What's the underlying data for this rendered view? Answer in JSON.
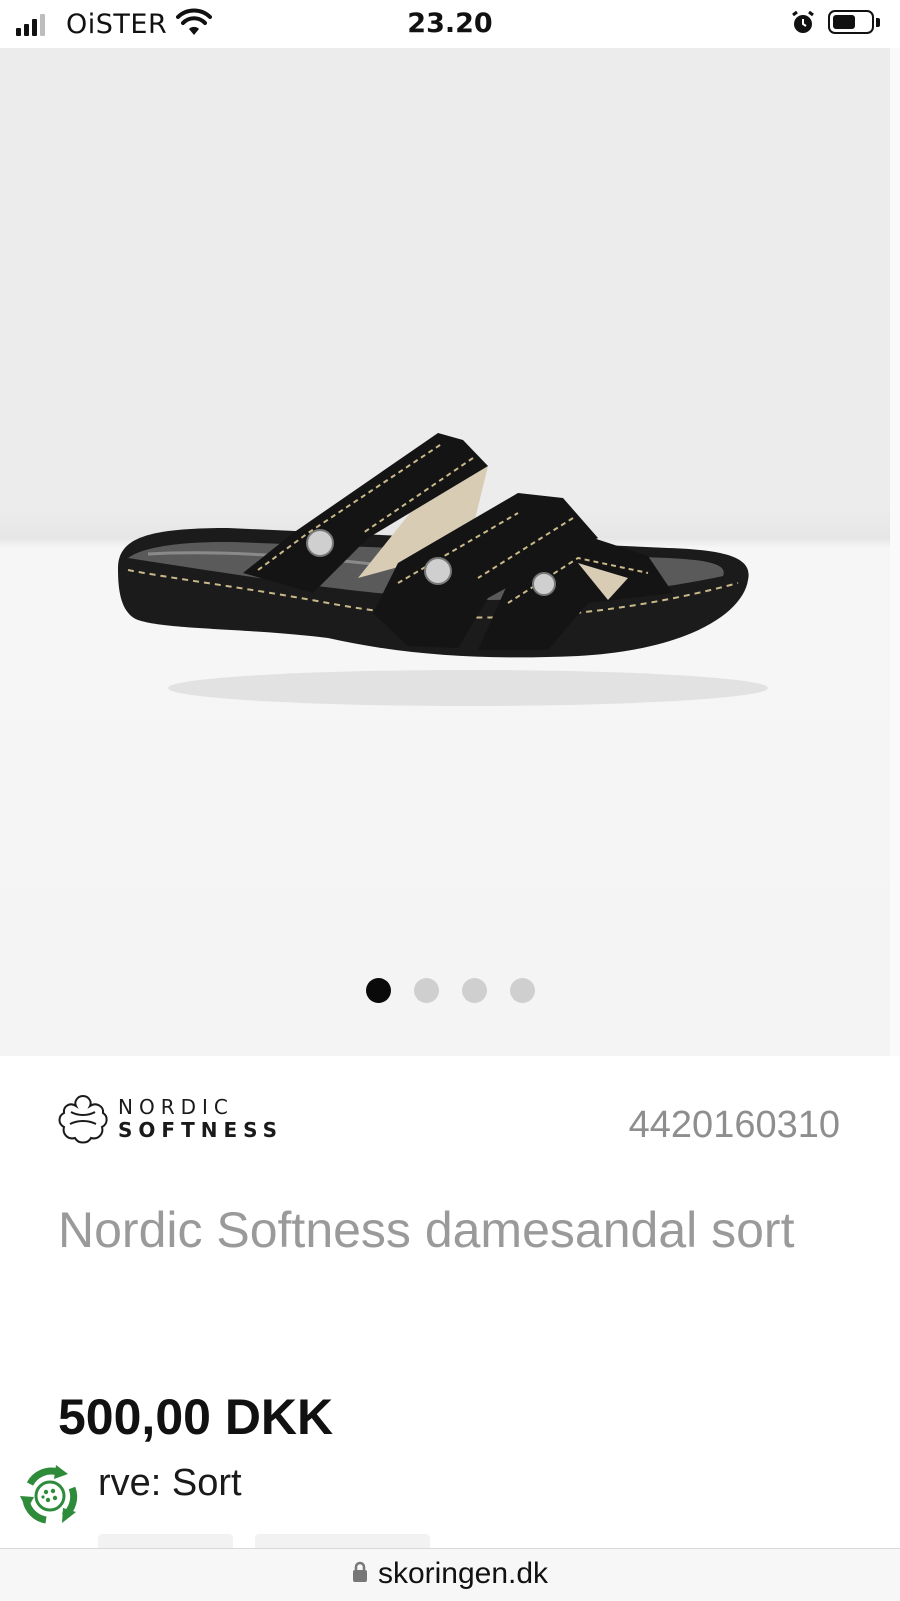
{
  "status_bar": {
    "carrier": "OiSTER",
    "time": "23.20",
    "signal_bars": 4,
    "signal_bars_active": 3,
    "battery_level": 0.6,
    "icons": [
      "signal-icon",
      "wifi-icon",
      "alarm-icon",
      "battery-icon"
    ]
  },
  "gallery": {
    "image": "black-sandal-product-photo",
    "dots_total": 4,
    "active_dot": 1
  },
  "product": {
    "brand_logo": {
      "line1": "NORDIC",
      "line2": "SOFTNESS"
    },
    "article_number": "4420160310",
    "title": "Nordic Softness damesandal sort",
    "price": "500,00 DKK",
    "color_label": "rve: Sort"
  },
  "browser": {
    "url": "skoringen.dk"
  },
  "colors": {
    "background": "#ffffff",
    "gallery_background": "#ececec",
    "active_dot": "#0a0a0a",
    "inactive_dot": "#cfcfcf",
    "title_text": "#9a9a9a",
    "article_number_text": "#8e8e8e",
    "badge_green": "#2e8b3a"
  }
}
